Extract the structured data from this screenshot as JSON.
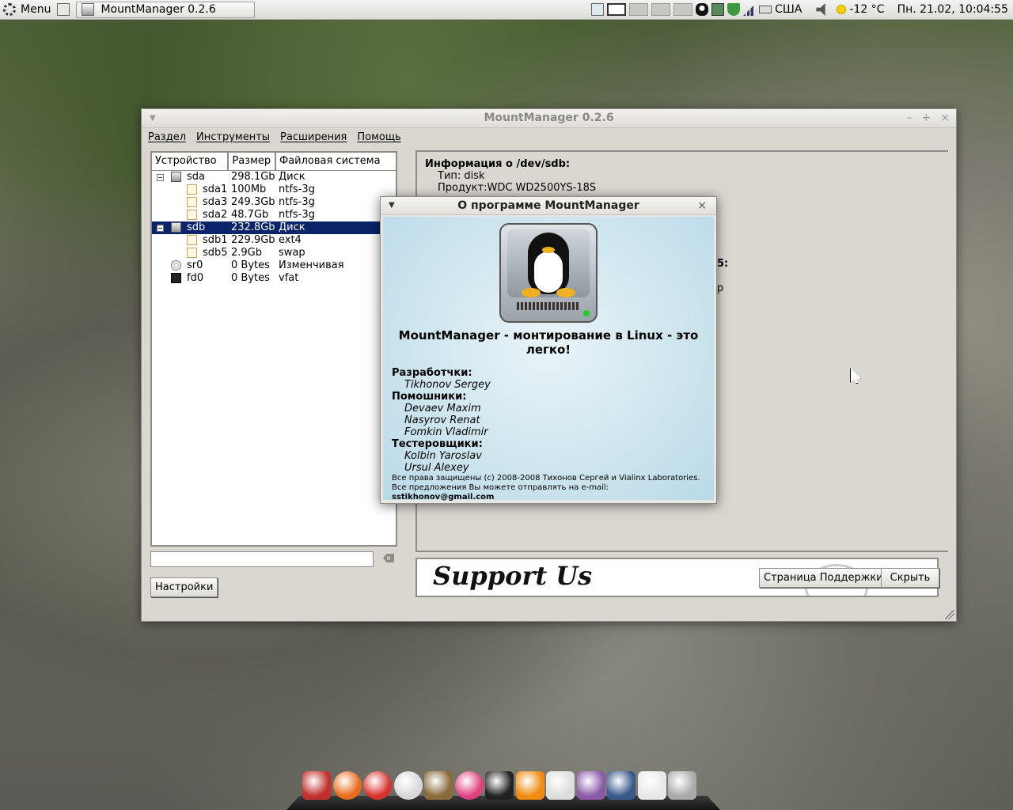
{
  "top_panel": {
    "menu_label": "Menu",
    "task_title": "MountManager 0.2.6",
    "keyboard_layout": "США",
    "weather": "-12 °C",
    "clock": "Пн. 21.02, 10:04:55"
  },
  "window": {
    "title": "MountManager 0.2.6",
    "menu": [
      "Раздел",
      "Инструменты",
      "Расширения",
      "Помощь"
    ],
    "tree_columns": [
      "Устройство",
      "Размер",
      "Файловая система"
    ],
    "devices": [
      {
        "name": "sda",
        "size": "298.1Gb",
        "fs": "Диск",
        "level": 0,
        "icon": "disk-icon",
        "selected": false
      },
      {
        "name": "sda1",
        "size": "100Mb",
        "fs": "ntfs-3g",
        "level": 1,
        "icon": "partition-icon",
        "selected": false
      },
      {
        "name": "sda3",
        "size": "249.3Gb",
        "fs": "ntfs-3g",
        "level": 1,
        "icon": "partition-icon",
        "selected": false
      },
      {
        "name": "sda2",
        "size": "48.7Gb",
        "fs": "ntfs-3g",
        "level": 1,
        "icon": "partition-icon",
        "selected": false
      },
      {
        "name": "sdb",
        "size": "232.8Gb",
        "fs": "Диск",
        "level": 0,
        "icon": "disk-icon",
        "selected": true
      },
      {
        "name": "sdb1",
        "size": "229.9Gb",
        "fs": "ext4",
        "level": 1,
        "icon": "partition-icon",
        "selected": false
      },
      {
        "name": "sdb5",
        "size": "2.9Gb",
        "fs": "swap",
        "level": 1,
        "icon": "partition-icon",
        "selected": false
      },
      {
        "name": "sr0",
        "size": "0 Bytes",
        "fs": "Изменчивая",
        "level": 0,
        "icon": "cdrom-icon",
        "selected": false
      },
      {
        "name": "fd0",
        "size": "0 Bytes",
        "fs": "vfat",
        "level": 0,
        "icon": "floppy-icon",
        "selected": false
      }
    ],
    "search_value": "",
    "settings_button": "Настройки",
    "info": {
      "header": "Информация о /dev/sdb:",
      "type_line": "Тип: disk",
      "product_line": "Продукт:WDC WD2500YS-18S",
      "peek_1": "5:",
      "peek_2": "р"
    },
    "support": {
      "banner": "Support Us",
      "support_page_button": "Страница Поддержки",
      "hide_button": "Скрыть"
    }
  },
  "about": {
    "title": "О программе MountManager",
    "tagline": "MountManager - монтирование в Linux - это легко!",
    "sections": [
      {
        "heading": "Разработчки:",
        "people": [
          "Tikhonov Sergey"
        ]
      },
      {
        "heading": "Помошники:",
        "people": [
          "Devaev Maxim",
          "Nasyrov Renat",
          "Fomkin Vladimir"
        ]
      },
      {
        "heading": "Тестеровщики:",
        "people": [
          "Kolbin Yaroslav",
          "Ursul Alexey"
        ]
      }
    ],
    "copyright": "Все права защищены (c) 2008-2008 Тихонов Сергей и Vialinx Laboratories. Все предложения Вы можете отправлять на e-mail:",
    "email": "sstikhonov@gmail.com"
  },
  "dock_icons": [
    "anchor-icon",
    "firefox-icon",
    "chrome-icon",
    "clock-icon",
    "dog-icon",
    "picasa-icon",
    "terminal-icon",
    "vlc-icon",
    "speaker-icon",
    "pidgin-icon",
    "files-icon",
    "tux-icon",
    "trash-icon"
  ]
}
